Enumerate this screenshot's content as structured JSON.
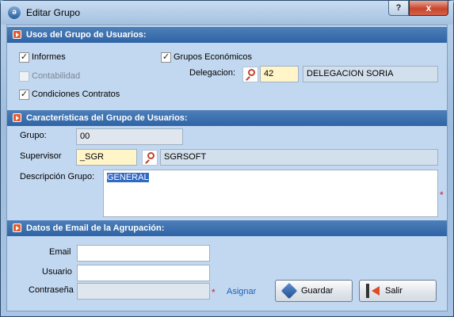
{
  "window": {
    "title": "Editar Grupo",
    "app_icon_glyph": "ə",
    "help_glyph": "?",
    "close_glyph": "x"
  },
  "sections": {
    "usos": "Usos del Grupo de Usuarios:",
    "caracteristicas": "Características del Grupo de Usuarios:",
    "email": "Datos de Email de la Agrupación:"
  },
  "usos": {
    "informes": {
      "label": "Informes",
      "checked": true
    },
    "contabilidad": {
      "label": "Contabilidad",
      "checked": false,
      "enabled": false
    },
    "condiciones": {
      "label": "Condiciones Contratos",
      "checked": true
    },
    "grupos_economicos": {
      "label": "Grupos Económicos",
      "checked": true
    },
    "delegacion_label": "Delegacion:",
    "delegacion_code": "42",
    "delegacion_name": "DELEGACION SORIA"
  },
  "caracteristicas": {
    "grupo_label": "Grupo:",
    "grupo_value": "00",
    "supervisor_label": "Supervisor",
    "supervisor_code": "_SGR",
    "supervisor_name": "SGRSOFT",
    "descripcion_label": "Descripción Grupo:",
    "descripcion_value": "GENERAL",
    "required_mark": "*"
  },
  "email": {
    "email_label": "Email",
    "email_value": "",
    "usuario_label": "Usuario",
    "usuario_value": "",
    "password_label": "Contraseña",
    "password_value": "",
    "required_mark": "*",
    "assign_link": "Asignar"
  },
  "buttons": {
    "save": "Guardar",
    "exit": "Salir"
  },
  "icons": {
    "check": "✓",
    "section": "arrow-right-icon",
    "lookup": "search-icon"
  },
  "colors": {
    "section_header": "#2e64a6",
    "required": "#c81e1e",
    "link": "#1f5fb5"
  }
}
